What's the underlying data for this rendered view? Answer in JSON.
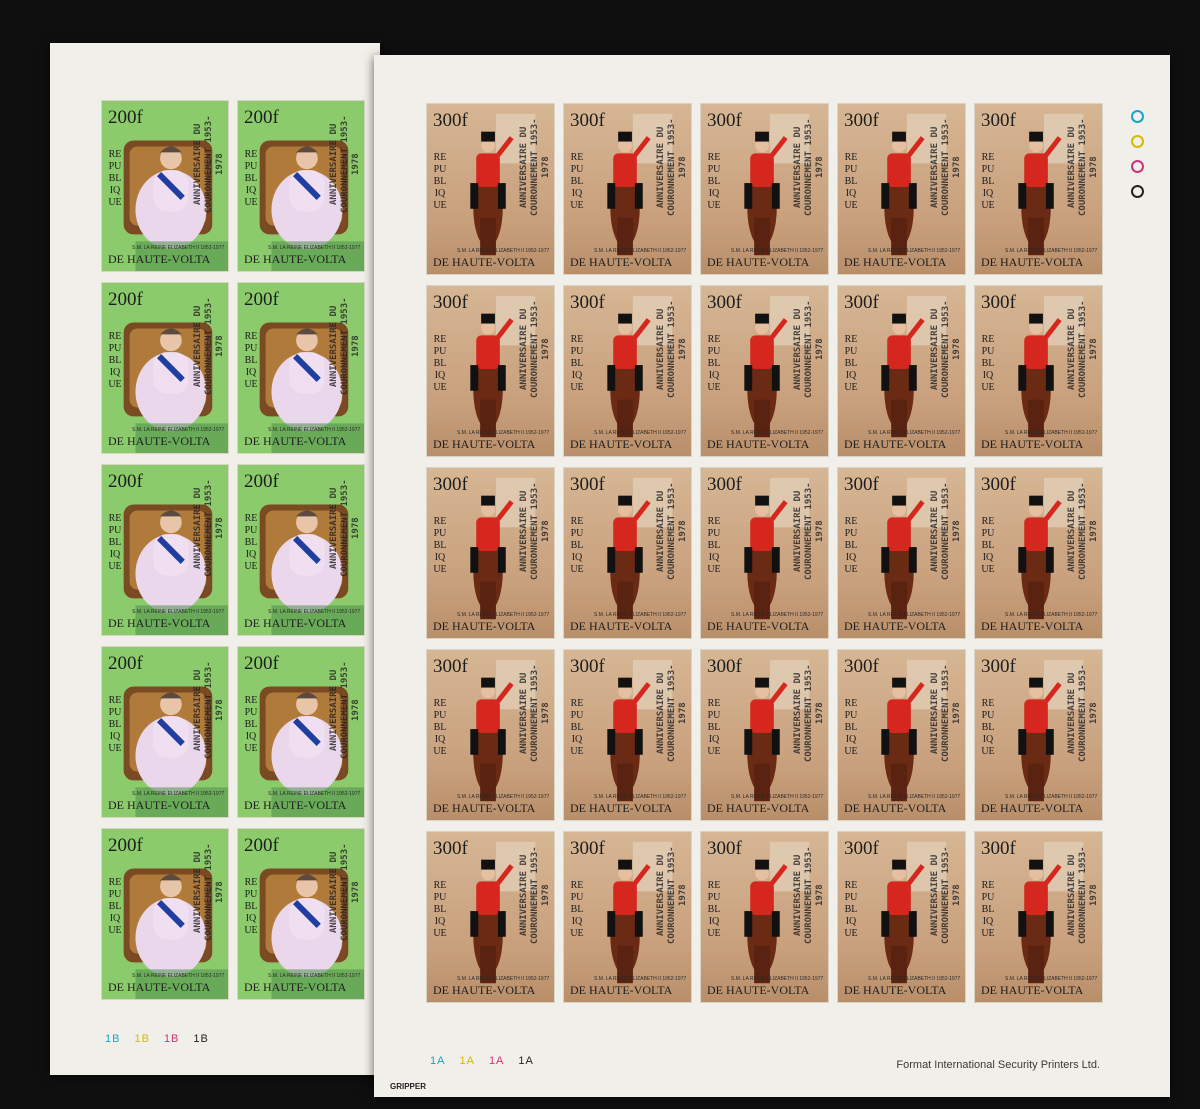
{
  "sheets": {
    "left": {
      "rows": 5,
      "cols": 2,
      "stamp": {
        "value": "200f",
        "republic": "REPUBLIQUE",
        "country": "DE HAUTE-VOLTA",
        "caption": "S.M. LA REINE ELIZABETH II 1952-1977",
        "overprint": "ANNIVERSAIRE DU COURONNEMENT 1953-1978"
      },
      "plate_marks": [
        "1B",
        "1B",
        "1B",
        "1B"
      ],
      "colors": {
        "background": "#8ccb6c",
        "robe": "#e9d6ea"
      }
    },
    "right": {
      "rows": 5,
      "cols": 5,
      "stamp": {
        "value": "300f",
        "republic": "REPUBLIQUE",
        "country": "DE HAUTE-VOLTA",
        "caption": "S.M. LA REINE ELIZABETH II 1952-1977",
        "overprint": "ANNIVERSAIRE DU COURONNEMENT 1953-1978"
      },
      "plate_marks": [
        "1A",
        "1A",
        "1A",
        "1A"
      ],
      "imprint": "Format International Security Printers Ltd.",
      "gripper": "GRIPPER",
      "registration_colors": [
        "#1aa3c9",
        "#d6b900",
        "#d2307a",
        "#222222"
      ]
    }
  }
}
